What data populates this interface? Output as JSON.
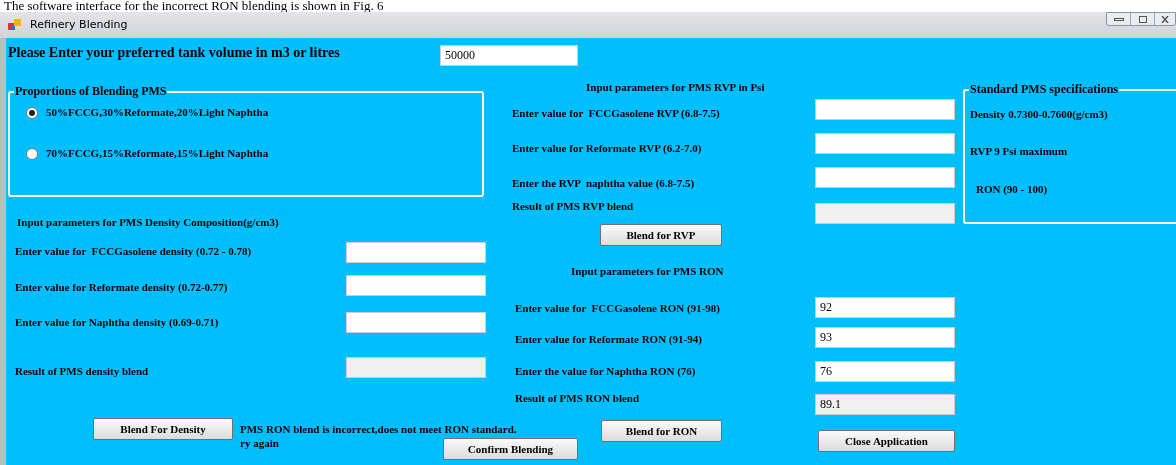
{
  "caption": "The software interface for the incorrect RON blending is shown in Fig. 6",
  "window": {
    "title": "Refinery Blending"
  },
  "tank": {
    "label": "Please Enter your preferred tank volume in m3 or litres",
    "value": "50000"
  },
  "proportions": {
    "title": "Proportions of Blending PMS",
    "options": [
      {
        "label": "50%FCCG,30%Reformate,20%Light Naphtha",
        "selected": true
      },
      {
        "label": "70%FCCG,15%Reformate,15%Light Naphtha",
        "selected": false
      }
    ]
  },
  "density": {
    "title": "Input parameters for PMS Density Composition(g/cm3)",
    "rows": [
      {
        "label": "Enter value for  FCCGasolene density (0.72 - 0.78)",
        "kind": "input"
      },
      {
        "label": "Enter value for Reformate density (0.72-0.77)",
        "kind": "input"
      },
      {
        "label": "Enter value for Naphtha density (0.69-0.71)",
        "kind": "input"
      },
      {
        "label": "Result of PMS density blend",
        "kind": "result"
      }
    ],
    "button": "Blend For Density"
  },
  "rvp": {
    "title": "Input parameters for PMS RVP in Psi",
    "rows": [
      {
        "label": "Enter value for  FCCGasolene RVP (6.8-7.5)",
        "kind": "input"
      },
      {
        "label": "Enter value for Reformate RVP (6.2-7.0)",
        "kind": "input"
      },
      {
        "label": "Enter the RVP  naphtha value (6.8-7.5)",
        "kind": "input"
      },
      {
        "label": "Result of PMS RVP blend",
        "kind": "result"
      }
    ],
    "button": "Blend for RVP"
  },
  "ron": {
    "title": "Input parameters for PMS RON",
    "rows": [
      {
        "label": "Enter value for  FCCGasolene RON (91-98)",
        "kind": "input",
        "value": "92"
      },
      {
        "label": "Enter value for Reformate RON (91-94)",
        "kind": "input",
        "value": "93"
      },
      {
        "label": "Enter the value for Naphtha RON (76)",
        "kind": "input",
        "value": "76"
      },
      {
        "label": "Result of PMS RON blend",
        "kind": "result",
        "value": "89.1"
      }
    ],
    "button": "Blend for RON"
  },
  "specs": {
    "title": "Standard PMS specifications",
    "lines": [
      "Density 0.7300-0.7600(g/cm3)",
      "RVP 9 Psi maximum",
      "RON (90 - 100)"
    ]
  },
  "message": {
    "line1": "PMS RON blend is incorrect,does not meet RON standard.",
    "line2": "ry again"
  },
  "buttons": {
    "confirm": "Confirm Blending",
    "close": "Close Application"
  }
}
